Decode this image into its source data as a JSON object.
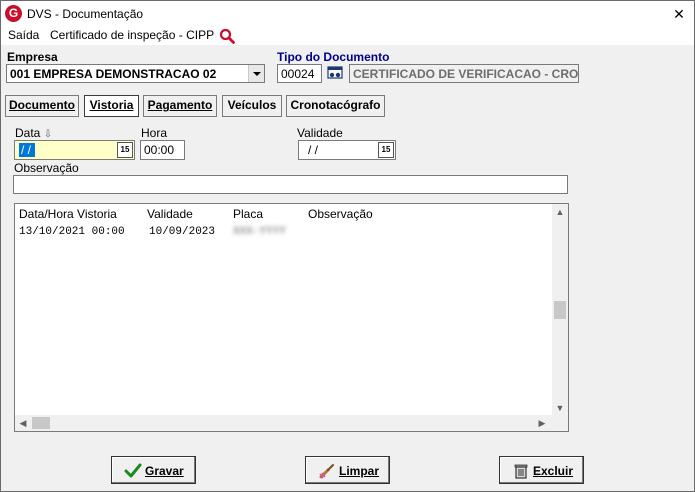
{
  "window": {
    "title": "DVS - Documentação",
    "logo_letter": "G",
    "close_glyph": "✕"
  },
  "menu": {
    "items": [
      "Saída",
      "Certificado de inspeção - CIPP"
    ]
  },
  "empresa": {
    "label": "Empresa",
    "value": "001 EMPRESA DEMONSTRACAO 02"
  },
  "tipo_documento": {
    "label": "Tipo do Documento",
    "code": "00024",
    "description": "CERTIFICADO DE VERIFICACAO - CRO"
  },
  "tabs": [
    {
      "label": "Documento",
      "active": false
    },
    {
      "label": "Vistoria",
      "active": true
    },
    {
      "label": "Pagamento",
      "active": false
    },
    {
      "label": "Veículos",
      "active": false
    },
    {
      "label": "Cronotacógrafo",
      "active": false
    }
  ],
  "form": {
    "data_label": "Data",
    "sort_glyph": "⇩",
    "data_value": "/ /",
    "hora_label": "Hora",
    "hora_value": "00:00",
    "validade_label": "Validade",
    "validade_value": "/ /",
    "observacao_label": "Observação",
    "observacao_value": "",
    "cal_glyph": "15"
  },
  "list": {
    "columns": [
      "Data/Hora Vistoria",
      "Validade",
      "Placa",
      "Observação"
    ],
    "rows": [
      {
        "data_hora": "13/10/2021 00:00",
        "validade": "10/09/2023",
        "placa": "XXX-YYYY",
        "observacao": ""
      }
    ]
  },
  "buttons": {
    "gravar": "Gravar",
    "limpar": "Limpar",
    "excluir": "Excluir"
  },
  "colors": {
    "accent": "#0078d7",
    "focus_field": "#ffffc8",
    "logo": "#c8102e",
    "tipo_label": "#00008b"
  }
}
